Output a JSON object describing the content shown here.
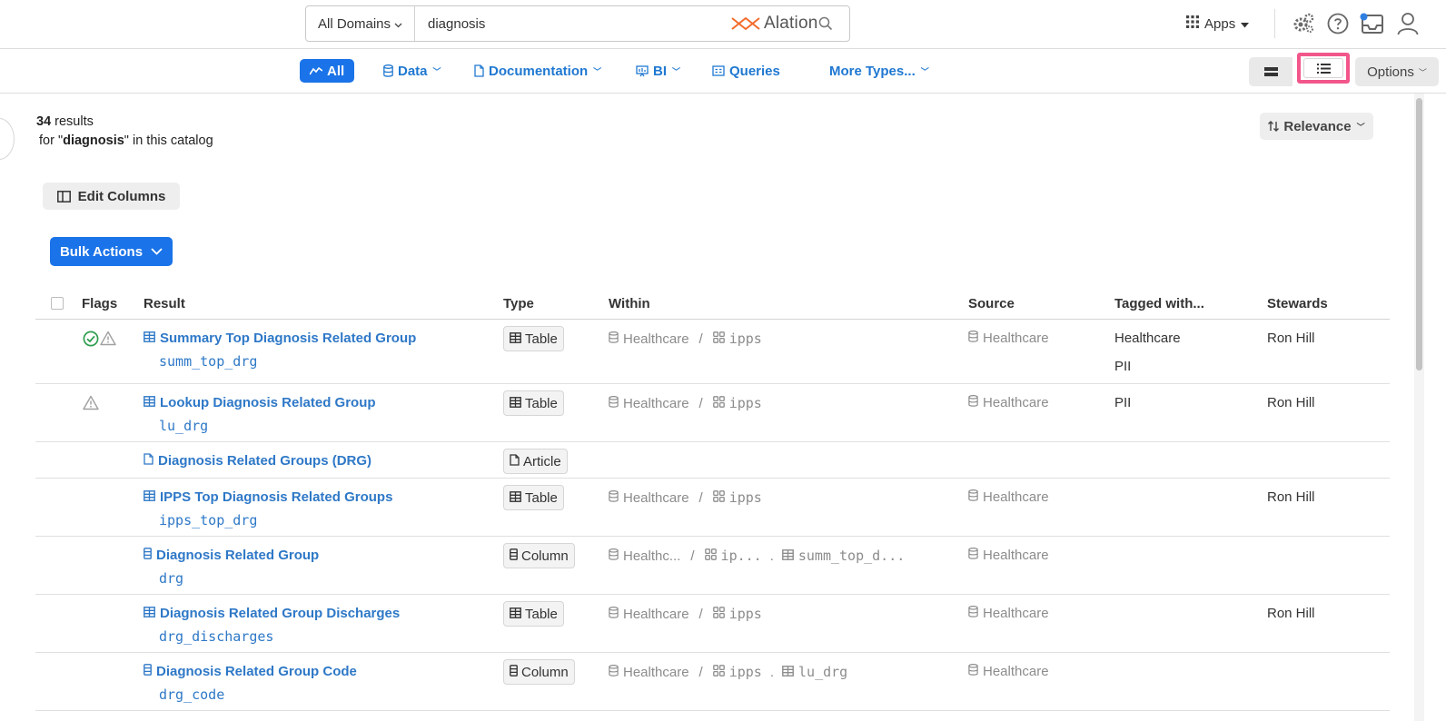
{
  "header": {
    "domain_select": "All Domains",
    "search_value": "diagnosis",
    "brand": "Alation",
    "apps_label": "Apps"
  },
  "filters": {
    "tabs": [
      {
        "label": "All",
        "icon": "all-activity-icon"
      },
      {
        "label": "Data",
        "icon": "database-icon"
      },
      {
        "label": "Documentation",
        "icon": "document-icon"
      },
      {
        "label": "BI",
        "icon": "bi-icon"
      },
      {
        "label": "Queries",
        "icon": "queries-icon"
      },
      {
        "label": "More Types...",
        "icon": ""
      }
    ],
    "options_label": "Options"
  },
  "results": {
    "count": "34",
    "count_suffix": " results",
    "for_prefix": "for \"",
    "query": "diagnosis",
    "for_suffix": "\" in this catalog",
    "sort_label": "Relevance",
    "edit_columns_label": "Edit Columns",
    "bulk_actions_label": "Bulk Actions"
  },
  "table": {
    "headers": {
      "flags": "Flags",
      "result": "Result",
      "type": "Type",
      "within": "Within",
      "source": "Source",
      "tagged": "Tagged with...",
      "stewards": "Stewards"
    },
    "rows": [
      {
        "title": "Summary Top Diagnosis Related Group",
        "code": "summ_top_drg",
        "type": "Table",
        "within_db": "Healthcare",
        "within_schema": "ipps",
        "within_table": "",
        "source": "Healthcare",
        "tags": [
          "Healthcare",
          "PII"
        ],
        "steward": "Ron Hill",
        "flags": [
          "endorsed",
          "warning"
        ]
      },
      {
        "title": "Lookup Diagnosis Related Group",
        "code": "lu_drg",
        "type": "Table",
        "within_db": "Healthcare",
        "within_schema": "ipps",
        "within_table": "",
        "source": "Healthcare",
        "tags": [
          "PII"
        ],
        "steward": "Ron Hill",
        "flags": [
          "warning"
        ]
      },
      {
        "title": "Diagnosis Related Groups (DRG)",
        "code": "",
        "type": "Article",
        "within_db": "",
        "within_schema": "",
        "within_table": "",
        "source": "",
        "tags": [],
        "steward": "",
        "flags": []
      },
      {
        "title": "IPPS Top Diagnosis Related Groups",
        "code": "ipps_top_drg",
        "type": "Table",
        "within_db": "Healthcare",
        "within_schema": "ipps",
        "within_table": "",
        "source": "Healthcare",
        "tags": [],
        "steward": "Ron Hill",
        "flags": []
      },
      {
        "title": "Diagnosis Related Group",
        "code": "drg",
        "type": "Column",
        "within_db": "Healthc...",
        "within_schema": "ip...",
        "within_table": "summ_top_d...",
        "source": "Healthcare",
        "tags": [],
        "steward": "",
        "flags": []
      },
      {
        "title": "Diagnosis Related Group Discharges",
        "code": "drg_discharges",
        "type": "Table",
        "within_db": "Healthcare",
        "within_schema": "ipps",
        "within_table": "",
        "source": "Healthcare",
        "tags": [],
        "steward": "Ron Hill",
        "flags": []
      },
      {
        "title": "Diagnosis Related Group Code",
        "code": "drg_code",
        "type": "Column",
        "within_db": "Healthcare",
        "within_schema": "ipps",
        "within_table": "lu_drg",
        "source": "Healthcare",
        "tags": [],
        "steward": "",
        "flags": []
      }
    ]
  },
  "colors": {
    "primary": "#1a73e8",
    "link": "#2e78c7",
    "highlight": "#f2568b",
    "endorsed": "#2e9e4f",
    "warning": "#9a9a9a",
    "brand_mark": "#f26b2b"
  }
}
